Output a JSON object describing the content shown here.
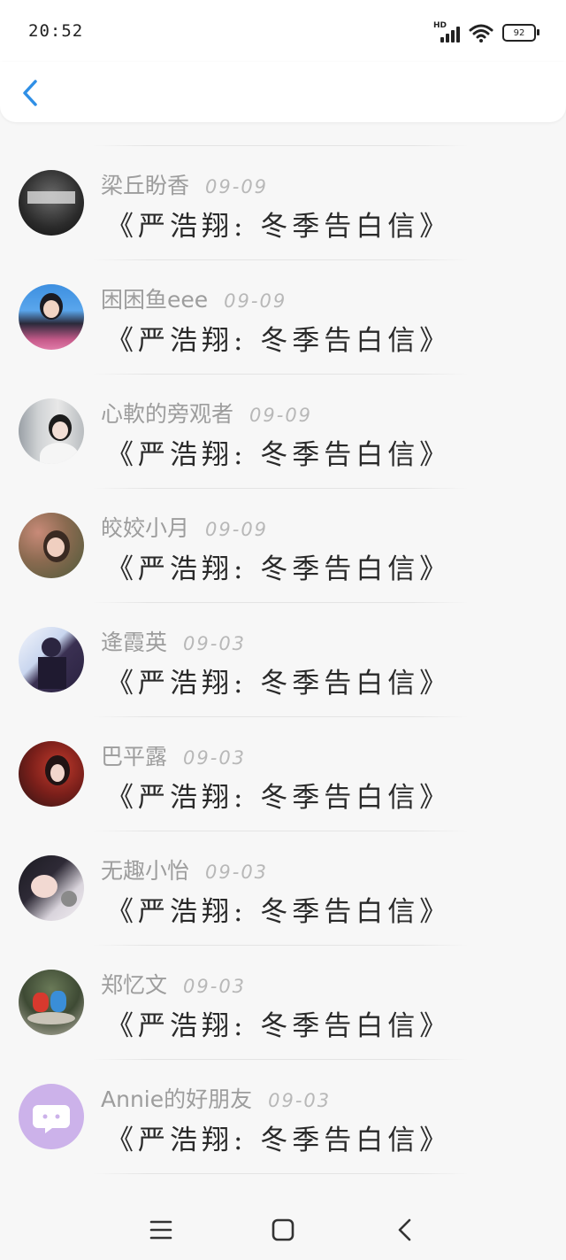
{
  "status_bar": {
    "time": "20:52",
    "network_label": "HD",
    "battery": "92",
    "icons": [
      "signal-icon",
      "wifi-icon",
      "battery-icon"
    ]
  },
  "header": {
    "back_icon": "chevron-left-icon",
    "accent_color": "#2f8fe6"
  },
  "list": {
    "items": [
      {
        "name": "梁丘盼香",
        "date": "09-09",
        "title": "《严浩翔: 冬季告白信》",
        "avatar": "avatar-1"
      },
      {
        "name": "困困鱼eee",
        "date": "09-09",
        "title": "《严浩翔: 冬季告白信》",
        "avatar": "avatar-2"
      },
      {
        "name": "心軟的旁观者",
        "date": "09-09",
        "title": "《严浩翔: 冬季告白信》",
        "avatar": "avatar-3"
      },
      {
        "name": "皎姣小月",
        "date": "09-09",
        "title": "《严浩翔: 冬季告白信》",
        "avatar": "avatar-4"
      },
      {
        "name": "逄霞英",
        "date": "09-03",
        "title": "《严浩翔: 冬季告白信》",
        "avatar": "avatar-5"
      },
      {
        "name": "巴平露",
        "date": "09-03",
        "title": "《严浩翔: 冬季告白信》",
        "avatar": "avatar-6"
      },
      {
        "name": "无趣小怡",
        "date": "09-03",
        "title": "《严浩翔: 冬季告白信》",
        "avatar": "avatar-7"
      },
      {
        "name": "郑忆文",
        "date": "09-03",
        "title": "《严浩翔: 冬季告白信》",
        "avatar": "avatar-8"
      },
      {
        "name": "Annie的好朋友",
        "date": "09-03",
        "title": "《严浩翔: 冬季告白信》",
        "avatar": "avatar-9"
      }
    ]
  },
  "nav_bar": {
    "icons": [
      "menu-icon",
      "home-square-icon",
      "back-triangle-icon"
    ]
  }
}
